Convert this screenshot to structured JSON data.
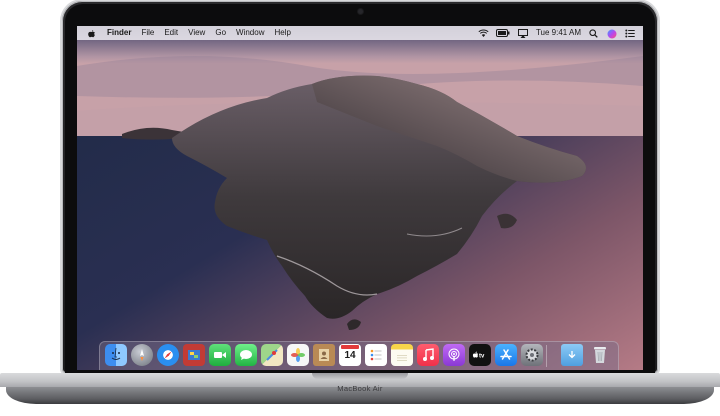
{
  "device": {
    "model_label": "MacBook Air"
  },
  "menubar": {
    "apple_icon": "apple-icon",
    "items": [
      "Finder",
      "File",
      "Edit",
      "View",
      "Go",
      "Window",
      "Help"
    ],
    "status_icons": [
      "wifi-icon",
      "battery-icon",
      "airplay-icon"
    ],
    "clock": "Tue 9:41 AM",
    "extra_icons": [
      "search-icon",
      "siri-icon",
      "notification-center-icon"
    ]
  },
  "dock": {
    "apps": [
      {
        "name": "Finder",
        "icon": "finder-icon",
        "color": "#3d8ef0"
      },
      {
        "name": "Launchpad",
        "icon": "launchpad-icon",
        "color": "#7b7f88"
      },
      {
        "name": "Safari",
        "icon": "safari-icon",
        "color": "#2a8ff0"
      },
      {
        "name": "Photo Booth",
        "icon": "photo-booth-icon",
        "color": "#c23b35"
      },
      {
        "name": "FaceTime",
        "icon": "facetime-icon",
        "color": "#2fbf4d"
      },
      {
        "name": "Messages",
        "icon": "messages-icon",
        "color": "#2fbf4d"
      },
      {
        "name": "Maps",
        "icon": "maps-icon",
        "color": "#69b86b"
      },
      {
        "name": "Photos",
        "icon": "photos-icon",
        "color": "#f5f5f5"
      },
      {
        "name": "Contacts",
        "icon": "contacts-icon",
        "color": "#b98a55"
      },
      {
        "name": "Calendar",
        "icon": "calendar-icon",
        "color": "#ffffff",
        "date": "14"
      },
      {
        "name": "Reminders",
        "icon": "reminders-icon",
        "color": "#ffffff"
      },
      {
        "name": "Notes",
        "icon": "notes-icon",
        "color": "#f7d54a"
      },
      {
        "name": "Music",
        "icon": "music-icon",
        "color": "#f2435a"
      },
      {
        "name": "Podcasts",
        "icon": "podcasts-icon",
        "color": "#a34fe0"
      },
      {
        "name": "TV",
        "icon": "tv-icon",
        "color": "#111111"
      },
      {
        "name": "App Store",
        "icon": "app-store-icon",
        "color": "#2a8ff0"
      },
      {
        "name": "System Preferences",
        "icon": "system-preferences-icon",
        "color": "#8a8d93"
      }
    ],
    "right": [
      {
        "name": "Downloads",
        "icon": "downloads-folder-icon",
        "color": "#5aa8e8"
      },
      {
        "name": "Trash",
        "icon": "trash-icon",
        "color": "#dcdfe3"
      }
    ]
  }
}
